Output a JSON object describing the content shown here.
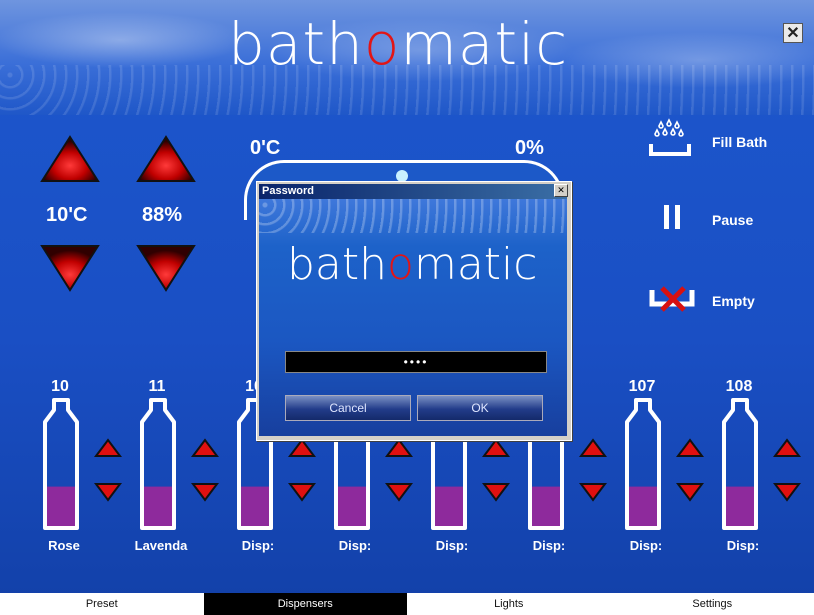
{
  "app": {
    "brand_prefix": "bath",
    "brand_o": "o",
    "brand_suffix": "matic",
    "close_glyph": "✕"
  },
  "controls": {
    "left_temp": "10'C",
    "left_level": "88%",
    "tank_temp": "0'C",
    "tank_level": "0%"
  },
  "actions": {
    "fill_label": "Fill Bath",
    "pause_label": "Pause",
    "empty_label": "Empty"
  },
  "dispensers": [
    {
      "number": "10",
      "label": "Rose",
      "fill": 0.45
    },
    {
      "number": "11",
      "label": "Lavenda",
      "fill": 0.45
    },
    {
      "number": "10",
      "label": "Disp:",
      "fill": 0.45
    },
    {
      "number": "",
      "label": "Disp:",
      "fill": 0.45
    },
    {
      "number": "",
      "label": "Disp:",
      "fill": 0.45
    },
    {
      "number": "",
      "label": "Disp:",
      "fill": 0.45
    },
    {
      "number": "107",
      "label": "Disp:",
      "fill": 0.45
    },
    {
      "number": "108",
      "label": "Disp:",
      "fill": 0.45
    }
  ],
  "tabs": [
    {
      "label": "Preset",
      "active": false
    },
    {
      "label": "Dispensers",
      "active": true
    },
    {
      "label": "Lights",
      "active": false
    },
    {
      "label": "Settings",
      "active": false
    }
  ],
  "dialog": {
    "title": "Password",
    "close_glyph": "✕",
    "brand_prefix": "bath",
    "brand_o": "o",
    "brand_suffix": "matic",
    "password_value": "••••",
    "cancel_label": "Cancel",
    "ok_label": "OK"
  },
  "colors": {
    "brand_o": "#e21515",
    "liquid": "#8e2a9c",
    "arrow": "#e01010"
  }
}
